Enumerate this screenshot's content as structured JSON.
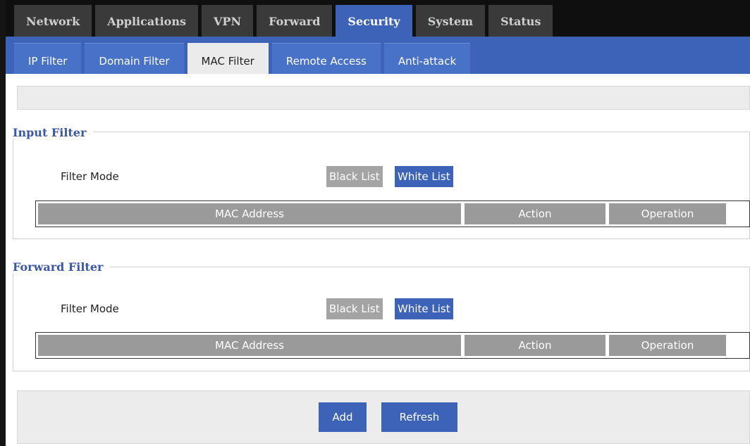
{
  "main_tabs": [
    {
      "label": "Network"
    },
    {
      "label": "Applications"
    },
    {
      "label": "VPN"
    },
    {
      "label": "Forward"
    },
    {
      "label": "Security"
    },
    {
      "label": "System"
    },
    {
      "label": "Status"
    }
  ],
  "main_tabs_active": "Security",
  "sub_tabs": [
    {
      "label": "IP Filter"
    },
    {
      "label": "Domain Filter"
    },
    {
      "label": "MAC Filter"
    },
    {
      "label": "Remote Access"
    },
    {
      "label": "Anti-attack"
    }
  ],
  "sub_tabs_active": "MAC Filter",
  "input_filter": {
    "title": "Input Filter",
    "mode_label": "Filter Mode",
    "black_list": "Black List",
    "white_list": "White List",
    "selected_mode": "White List",
    "columns": [
      "MAC Address",
      "Action",
      "Operation"
    ]
  },
  "forward_filter": {
    "title": "Forward Filter",
    "mode_label": "Filter Mode",
    "black_list": "Black List",
    "white_list": "White List",
    "selected_mode": "White List",
    "columns": [
      "MAC Address",
      "Action",
      "Operation"
    ]
  },
  "actions": {
    "add": "Add",
    "refresh": "Refresh"
  },
  "colors": {
    "accent": "#3c63b7",
    "tab_inactive": "#3a3a3a",
    "header_cell": "#9a9a9a"
  }
}
